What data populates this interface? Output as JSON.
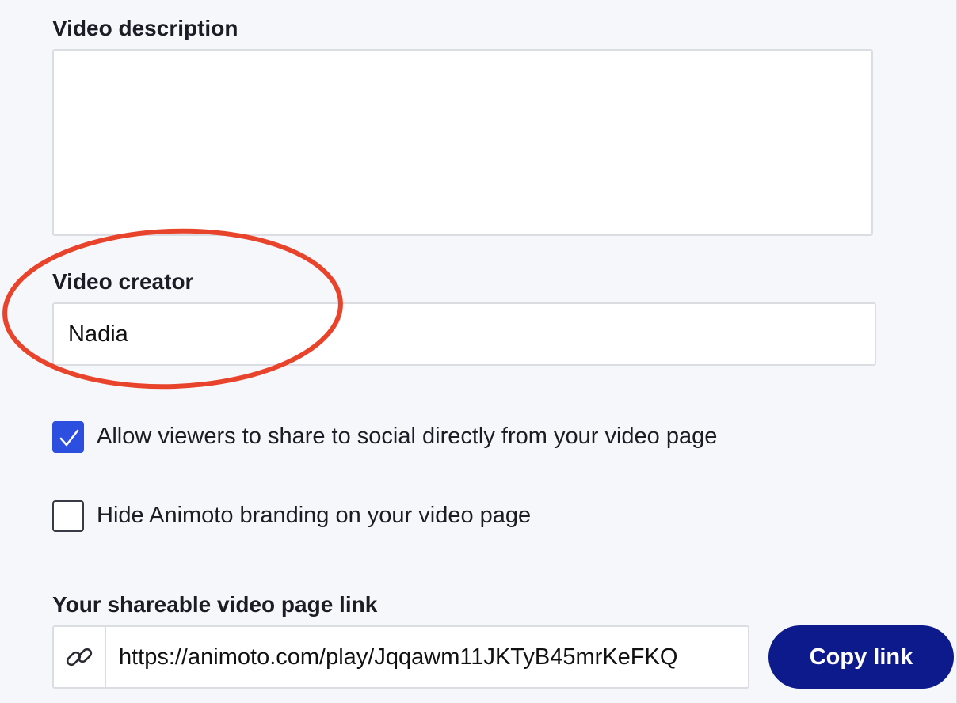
{
  "description": {
    "label": "Video description",
    "value": ""
  },
  "creator": {
    "label": "Video creator",
    "value": "Nadia"
  },
  "options": [
    {
      "label": "Allow viewers to share to social directly from your video page",
      "checked": true
    },
    {
      "label": "Hide Animoto branding on your video page",
      "checked": false
    }
  ],
  "share": {
    "label": "Your shareable video page link",
    "url": "https://animoto.com/play/Jqqawm11JKTyB45mrKeFKQ",
    "copy_label": "Copy link"
  },
  "colors": {
    "accent": "#2c4fe0",
    "button": "#0d1a8c",
    "annotation": "#e8442c",
    "background": "#f6f7fb"
  },
  "icons": {
    "link": "link-icon",
    "check": "checkmark-icon"
  }
}
